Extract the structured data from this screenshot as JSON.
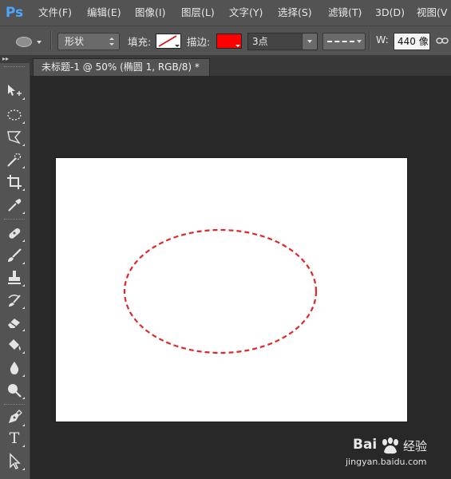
{
  "app": {
    "logo": "Ps",
    "accent_color": "#4aa6ff"
  },
  "menu": [
    "文件(F)",
    "编辑(E)",
    "图像(I)",
    "图层(L)",
    "文字(Y)",
    "选择(S)",
    "滤镜(T)",
    "3D(D)",
    "视图(V"
  ],
  "options_bar": {
    "tool_preset_icon": "ellipse-tool-icon",
    "mode_value": "形状",
    "fill_label": "填充:",
    "fill_value": "none",
    "stroke_label": "描边:",
    "stroke_color": "#ff0000",
    "stroke_size": "3点",
    "stroke_style": "dashed",
    "width_label": "W:",
    "width_value": "440 像",
    "link_icon": "link-icon"
  },
  "toolbox": {
    "tools": [
      "move-tool-icon",
      "elliptical-marquee-icon",
      "polygonal-lasso-icon",
      "quick-selection-icon",
      "crop-icon",
      "eyedropper-icon",
      "spot-healing-icon",
      "brush-icon",
      "clone-stamp-icon",
      "history-brush-icon",
      "eraser-icon",
      "paint-bucket-icon",
      "blur-icon",
      "dodge-icon",
      "pen-icon",
      "type-icon",
      "path-selection-icon"
    ],
    "type_glyph": "T"
  },
  "document": {
    "tab_title": "未标题-1 @ 50% (椭圆 1, RGB/8) *",
    "canvas_color": "#ffffff",
    "shape": {
      "type": "ellipse",
      "stroke_color": "#e02828",
      "stroke_style": "dashed"
    }
  },
  "watermark": {
    "brand": "Bai",
    "brand_cn": "经验",
    "url": "jingyan.baidu.com"
  }
}
